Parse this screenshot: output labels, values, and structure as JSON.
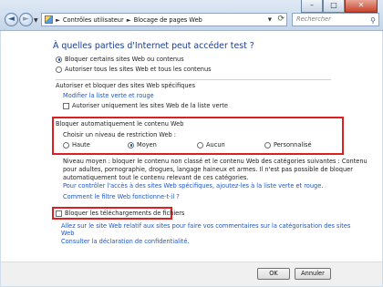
{
  "window": {
    "back_glyph": "◄",
    "forward_glyph": "►",
    "minimize_glyph": "–",
    "maximize_glyph": "□",
    "close_glyph": "✕",
    "breadcrumb": [
      "Contrôles utilisateur",
      "Blocage de pages Web"
    ],
    "breadcrumb_sep": "►",
    "search_placeholder": "Rechercher"
  },
  "main": {
    "title": "À quelles parties d'Internet peut accéder test ?",
    "options": [
      {
        "label": "Bloquer certains sites Web ou contenus",
        "selected": true
      },
      {
        "label": "Autoriser tous les sites Web et tous les contenus",
        "selected": false
      }
    ],
    "allow_block": {
      "heading": "Autoriser et bloquer des sites Web spécifiques",
      "edit_link": "Modifier la liste verte et rouge",
      "only_allowed_label": "Autoriser uniquement les sites Web de la liste verte"
    },
    "auto_block": {
      "heading": "Bloquer automatiquement le contenu Web",
      "level_prompt": "Choisir un niveau de restriction Web :",
      "levels": [
        {
          "label": "Haute",
          "selected": false
        },
        {
          "label": "Moyen",
          "selected": true
        },
        {
          "label": "Aucun",
          "selected": false
        },
        {
          "label": "Personnalisé",
          "selected": false
        }
      ],
      "description": [
        "Niveau moyen : bloquer le contenu non classé et le contenu Web des catégories suivantes : Contenu",
        "pour adultes, pornographie, drogues, langage haineux et armes. Il n'est pas possible de bloquer",
        "automatiquement tout le contenu relevant de ces catégories."
      ],
      "control_link": "Pour contrôler l'accès à des sites Web spécifiques, ajoutez-les à la liste verte et rouge.",
      "how_link": "Comment le filtre Web fonctionne-t-il ?"
    },
    "downloads": {
      "label": "Bloquer les téléchargements de fichiers"
    },
    "footer_links": {
      "sites_link": [
        "Allez sur le site Web relatif aux sites pour faire vos commentaires sur la catégorisation des sites",
        "Web"
      ],
      "privacy_link": "Consulter la déclaration de confidentialité."
    }
  },
  "buttons": {
    "ok": "OK",
    "cancel": "Annuler"
  },
  "colors": {
    "highlight_box": "#dd1f1f",
    "title": "#1a3e91",
    "link": "#1c56c7"
  }
}
